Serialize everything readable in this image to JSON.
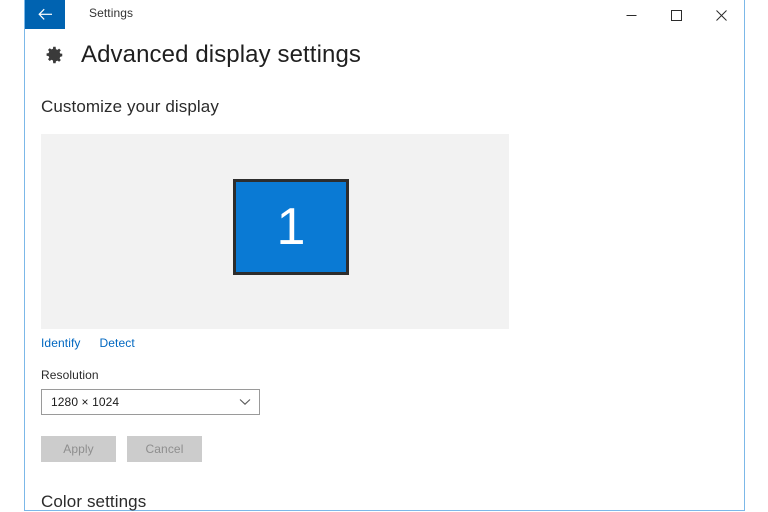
{
  "window": {
    "title": "Settings",
    "back_icon": "back-arrow-icon",
    "controls": {
      "minimize": "minimize-icon",
      "maximize": "maximize-icon",
      "close": "close-icon"
    },
    "accent_color": "#0063b1",
    "border_color": "#7cb8e8"
  },
  "page": {
    "icon": "gear-icon",
    "title": "Advanced display settings",
    "section_heading": "Customize your display"
  },
  "display_preview": {
    "panel_background": "#f2f2f2",
    "monitor": {
      "number": "1",
      "color": "#0a7ad4",
      "border_color": "#2d2d2d"
    },
    "links": [
      {
        "label": "Identify",
        "name": "identify-link"
      },
      {
        "label": "Detect",
        "name": "detect-link"
      }
    ],
    "link_color": "#0067c0"
  },
  "resolution": {
    "label": "Resolution",
    "value": "1280 × 1024",
    "chevron_icon": "chevron-down-icon"
  },
  "actions": {
    "apply_label": "Apply",
    "cancel_label": "Cancel",
    "disabled_background": "#cccccc",
    "disabled_text_color": "#8e8e8e"
  },
  "bottom": {
    "color_settings_heading": "Color settings"
  }
}
